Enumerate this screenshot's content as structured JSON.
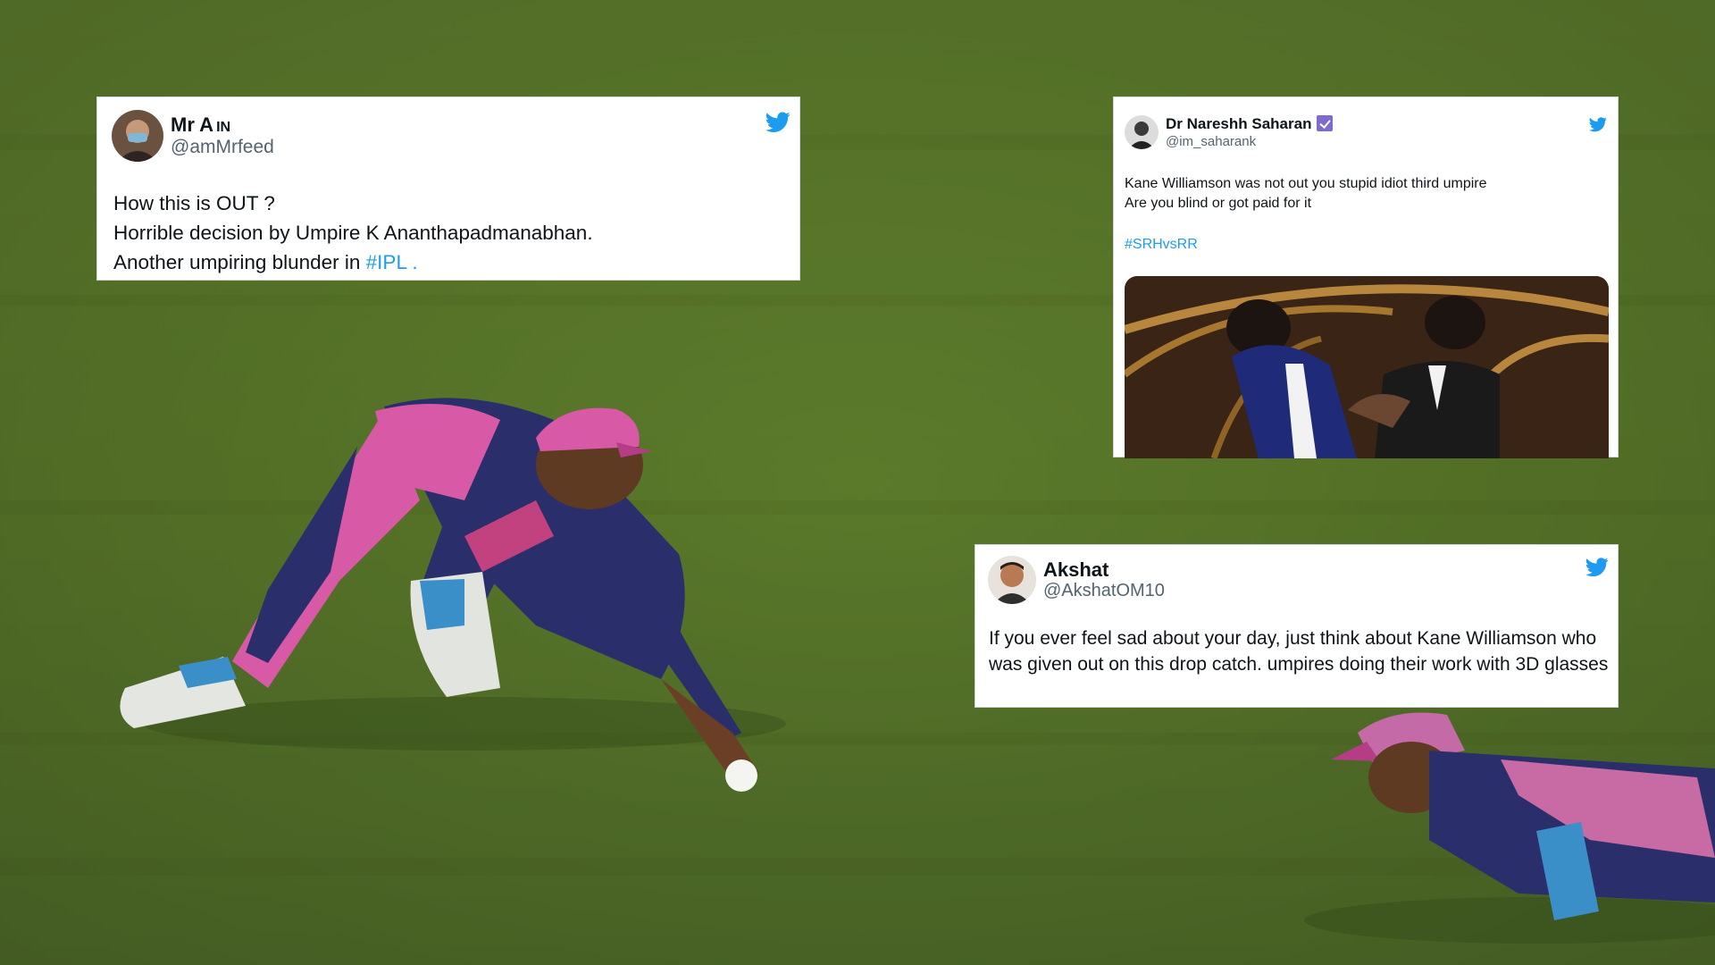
{
  "tweets": [
    {
      "display_name": "Mr A",
      "flag": "IN",
      "handle": "@amMrfeed",
      "lines": [
        "How this is OUT ?",
        "Horrible decision by Umpire K Ananthapadmanabhan.",
        "Another umpiring blunder in "
      ],
      "hashtag": "#IPL .",
      "icon": "twitter-bird-icon"
    },
    {
      "display_name": "Dr Nareshh Saharan",
      "handle": "@im_saharank",
      "lines": [
        "Kane Williamson was not out you stupid idiot third umpire",
        "Are you blind or got paid for it"
      ],
      "hashtag": "#SRHvsRR",
      "icon": "twitter-bird-icon",
      "has_media": true
    },
    {
      "display_name": "Akshat",
      "handle": "@AkshatOM10",
      "text": "If you ever feel sad about your day, just think about Kane Williamson who was given out on this drop catch. umpires doing their work with 3D glasses",
      "icon": "twitter-bird-icon"
    }
  ],
  "colors": {
    "grass": "#5d7a2c",
    "twitter_blue": "#1d9bf0",
    "jersey_pink": "#d85aa6",
    "jersey_navy": "#2a2f6b"
  }
}
